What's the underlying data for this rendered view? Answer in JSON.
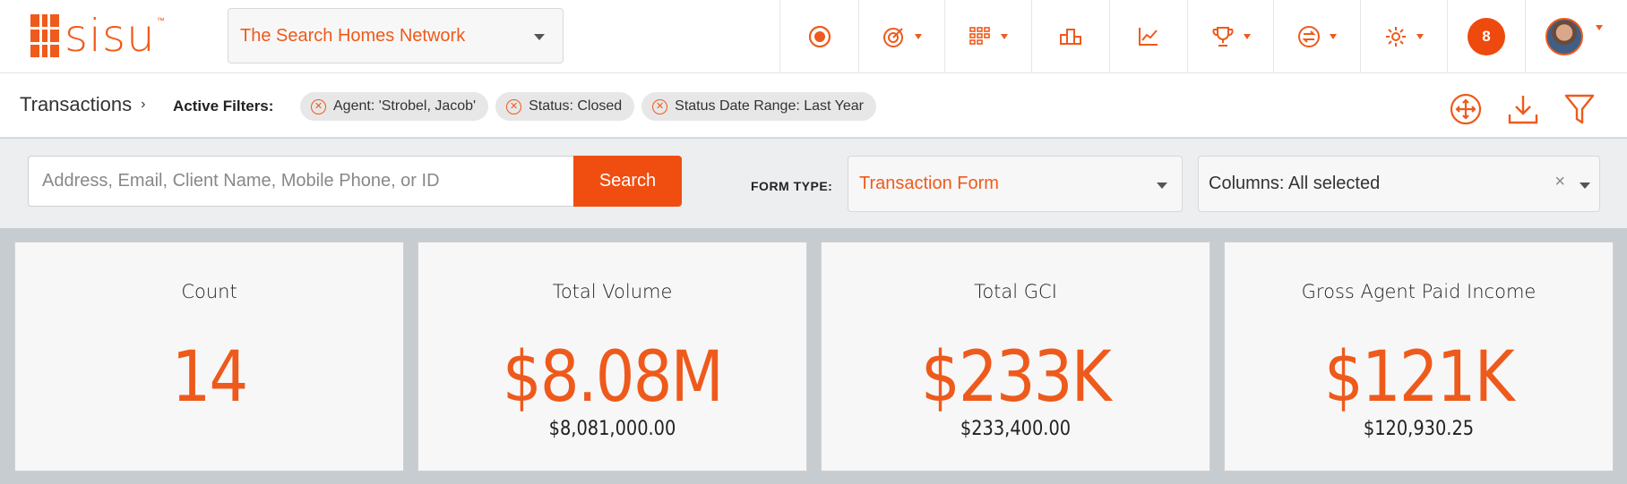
{
  "brand": {
    "name": "sisu",
    "tm": "™",
    "accent": "#ee5a1b"
  },
  "team_select": {
    "value": "The Search Homes Network"
  },
  "nav": {
    "icons": [
      "record-icon",
      "target-icon",
      "grid-icon",
      "podium-icon",
      "trend-chart-icon",
      "trophy-icon",
      "transfer-icon",
      "gear-icon"
    ],
    "notification_count": "8"
  },
  "breadcrumb": {
    "page": "Transactions"
  },
  "filters": {
    "label": "Active Filters:",
    "chips": [
      "Agent: 'Strobel, Jacob'",
      "Status: Closed",
      "Status Date Range: Last Year"
    ]
  },
  "search": {
    "placeholder": "Address, Email, Client Name, Mobile Phone, or ID",
    "button": "Search"
  },
  "form_type": {
    "label": "FORM TYPE:",
    "value": "Transaction Form"
  },
  "columns": {
    "value": "Columns: All selected",
    "clear": "×"
  },
  "stats": [
    {
      "title": "Count",
      "big": "14",
      "sub": ""
    },
    {
      "title": "Total Volume",
      "big": "$8.08M",
      "sub": "$8,081,000.00"
    },
    {
      "title": "Total GCI",
      "big": "$233K",
      "sub": "$233,400.00"
    },
    {
      "title": "Gross Agent Paid Income",
      "big": "$121K",
      "sub": "$120,930.25"
    }
  ]
}
